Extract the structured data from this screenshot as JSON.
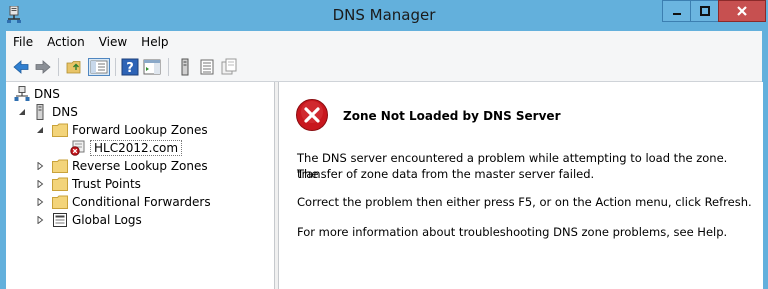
{
  "window": {
    "title": "DNS Manager"
  },
  "menu": [
    "File",
    "Action",
    "View",
    "Help"
  ],
  "toolbar_icons": [
    "back-icon",
    "forward-icon",
    "up-folder-icon",
    "show-hide-tree-icon",
    "help-icon",
    "action-pane-icon",
    "server-icon",
    "records-icon",
    "copy-icon"
  ],
  "tree": {
    "root": "DNS",
    "server": "DNS",
    "forward_zones": "Forward Lookup Zones",
    "zone": "HLC2012.com",
    "reverse_zones": "Reverse Lookup Zones",
    "trust_points": "Trust Points",
    "conditional_forwarders": "Conditional Forwarders",
    "global_logs": "Global Logs"
  },
  "detail": {
    "title": "Zone Not Loaded by DNS Server",
    "para1_line1": "The DNS server encountered a problem while attempting to load the zone. The",
    "para1_line2": "transfer of zone data from the master server failed.",
    "para2": "Correct the problem then either press F5, or on the Action menu, click Refresh.",
    "para3": "For more information about troubleshooting DNS zone problems, see Help."
  },
  "colors": {
    "titlebar": "#63b0dc",
    "close_button": "#c75050",
    "error_red": "#c8171e"
  }
}
